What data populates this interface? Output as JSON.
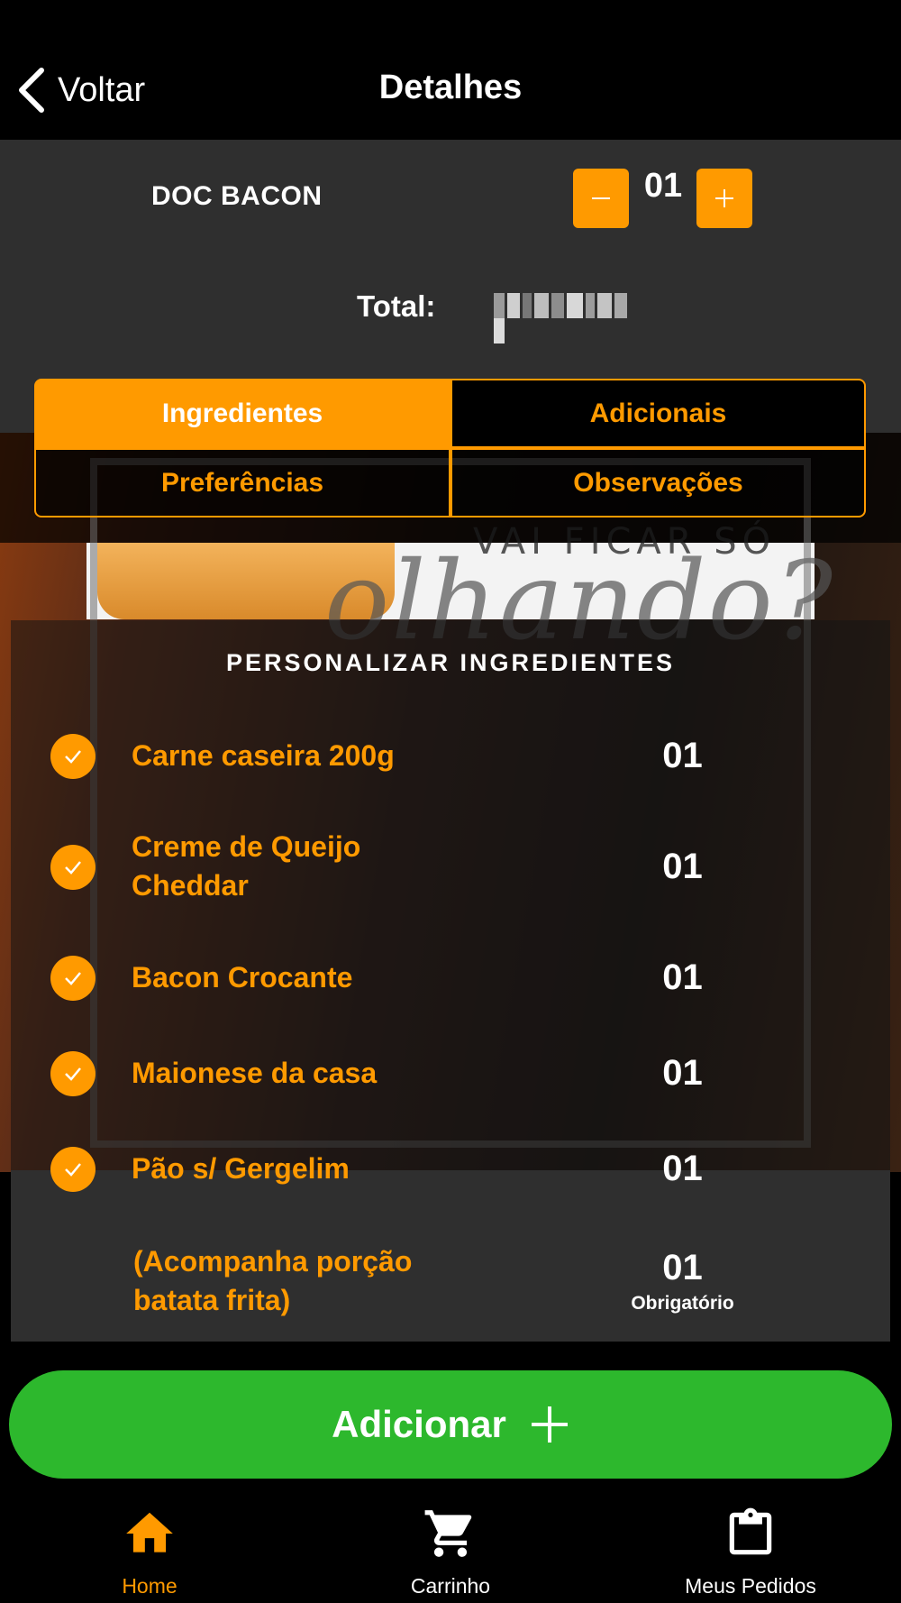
{
  "header": {
    "back_label": "Voltar",
    "title": "Detalhes"
  },
  "product": {
    "name": "DOC BACON",
    "quantity": "01",
    "total_label": "Total:"
  },
  "tabs": {
    "ingredientes": "Ingredientes",
    "adicionais": "Adicionais",
    "preferencias": "Preferências",
    "observacoes": "Observações",
    "active": "Ingredientes"
  },
  "promo": {
    "small_text": "VAI FICAR SÓ",
    "script_text": "olhando?"
  },
  "ingredients": {
    "title": "PERSONALIZAR INGREDIENTES",
    "items": [
      {
        "name": "Carne caseira 200g",
        "qty": "01",
        "checked": true
      },
      {
        "name": "Creme de Queijo Cheddar",
        "qty": "01",
        "checked": true
      },
      {
        "name": "Bacon Crocante",
        "qty": "01",
        "checked": true
      },
      {
        "name": "Maionese da casa",
        "qty": "01",
        "checked": true
      },
      {
        "name": "Pão s/ Gergelim",
        "qty": "01",
        "checked": true
      },
      {
        "name": "(Acompanha porção batata frita)",
        "qty": "01",
        "required_label": "Obrigatório"
      }
    ]
  },
  "add_button": {
    "label": "Adicionar"
  },
  "nav": {
    "home": "Home",
    "cart": "Carrinho",
    "orders": "Meus Pedidos"
  },
  "colors": {
    "accent": "#ff9a00",
    "add_green": "#2db82d",
    "band": "#2f2f2f"
  }
}
